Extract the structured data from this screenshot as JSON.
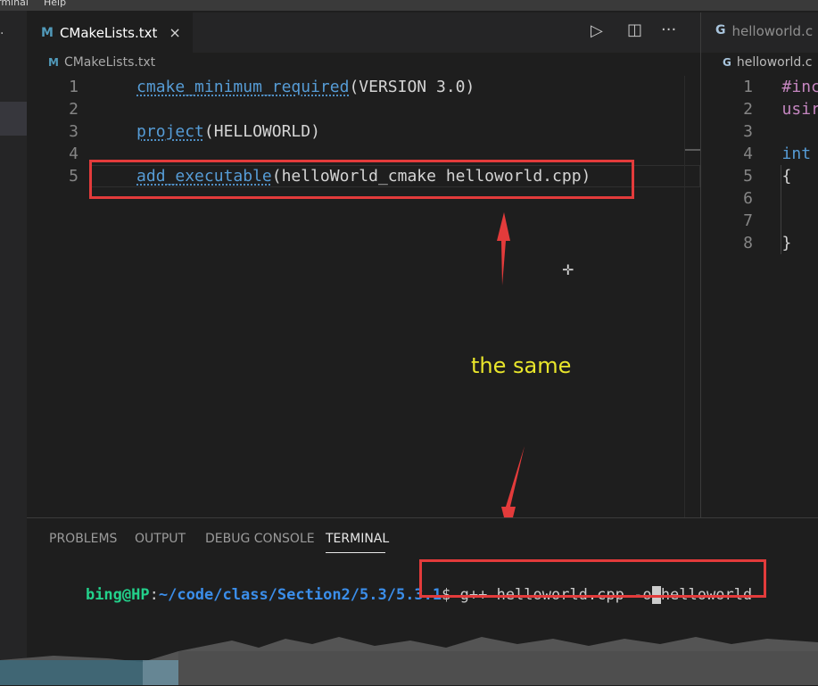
{
  "menubar": {
    "items": [
      "rminal",
      "Help"
    ]
  },
  "editor_left": {
    "tab": {
      "icon": "M",
      "label": "CMakeLists.txt",
      "close": "×"
    },
    "toolbar": {
      "run": "▷",
      "split": "◫",
      "more": "···"
    },
    "breadcrumb": {
      "icon": "M",
      "label": "CMakeLists.txt"
    },
    "lines": [
      {
        "n": "1",
        "fn": "cmake_minimum_required",
        "rest": "(VERSION 3.0)"
      },
      {
        "n": "2",
        "fn": "",
        "rest": ""
      },
      {
        "n": "3",
        "fn": "project",
        "rest": "(HELLOWORLD)"
      },
      {
        "n": "4",
        "fn": "",
        "rest": ""
      },
      {
        "n": "5",
        "fn": "add_executable",
        "rest": "(helloWorld_cmake helloworld.cpp)"
      }
    ]
  },
  "editor_right": {
    "tab": {
      "icon": "G",
      "label": "helloworld.c"
    },
    "breadcrumb": {
      "icon": "G",
      "label": "helloworld.c"
    },
    "lines": [
      {
        "n": "1",
        "text": "#inc"
      },
      {
        "n": "2",
        "text": "usir"
      },
      {
        "n": "3",
        "text": ""
      },
      {
        "n": "4",
        "text": "int "
      },
      {
        "n": "5",
        "text": "{"
      },
      {
        "n": "6",
        "text": ""
      },
      {
        "n": "7",
        "text": ""
      },
      {
        "n": "8",
        "text": "}"
      }
    ]
  },
  "annotation": {
    "text": "the same"
  },
  "panel": {
    "tabs": [
      "PROBLEMS",
      "OUTPUT",
      "DEBUG CONSOLE",
      "TERMINAL"
    ],
    "terminal": {
      "user_host": "bing@HP",
      "sep": ":",
      "path": "~/code/class/Section2/5.3/5.3.1",
      "prompt": "$",
      "command_a": " g++ helloworld.cpp -o",
      "command_b": "helloworld"
    }
  },
  "colors": {
    "accent": "#569cd6",
    "annotation_red": "#e33b3b",
    "annotation_yellow": "#e9e62b"
  }
}
